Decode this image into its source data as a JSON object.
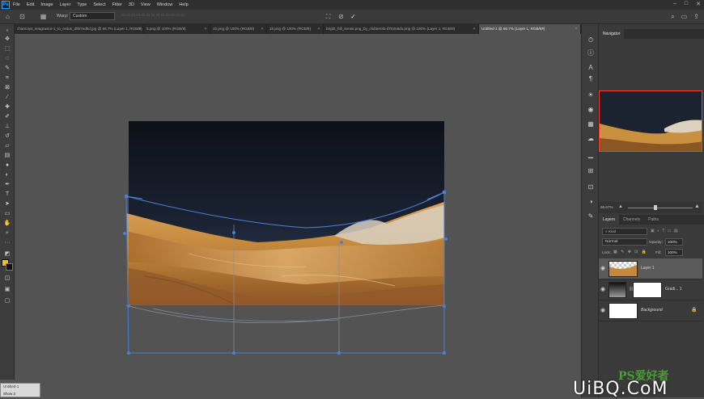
{
  "menu": {
    "logo": "Ps",
    "items": [
      "File",
      "Edit",
      "Image",
      "Layer",
      "Type",
      "Select",
      "Filter",
      "3D",
      "View",
      "Window",
      "Help"
    ]
  },
  "options": {
    "warp_label": "Warp:",
    "warp_value": "Custom"
  },
  "tabs": [
    {
      "label": "chamoiys_seagravior-1_to_redus_d9b7ed5d.jpg @ 66.7% (Layer 1, RGB/8)",
      "active": false
    },
    {
      "label": "5.png @ 100% (RGB/8)",
      "active": false
    },
    {
      "label": "10.png @ 100% (RGB/8)",
      "active": false
    },
    {
      "label": "15.png @ 100% (RGB/8)",
      "active": false
    },
    {
      "label": "bright_hill_sense.png_by_clubterolo-d7t4m8do.png @ 100% (Layer 1, RGB/8)",
      "active": false
    },
    {
      "label": "Untitled-1 @ 66.7% (Layer 1, RGB/8#)",
      "active": true
    }
  ],
  "navigator": {
    "tab": "Navigator",
    "zoom": "66.67%"
  },
  "layers_panel": {
    "tabs": [
      "Layers",
      "Channels",
      "Paths"
    ],
    "kind_placeholder": "Kind",
    "blend_mode": "Normal",
    "opacity_label": "Opacity:",
    "opacity_value": "100%",
    "lock_label": "Lock:",
    "fill_label": "Fill:",
    "fill_value": "100%",
    "layers": [
      {
        "name": "Layer 1",
        "selected": true
      },
      {
        "name": "Gradi... 1",
        "selected": false
      },
      {
        "name": "Background",
        "selected": false
      }
    ]
  },
  "bottom_mini": {
    "title": "Untitled-1",
    "label": "Show 2"
  },
  "watermark": {
    "top_text": "PS爱好者",
    "bottom_text": "UiBQ.CoM"
  },
  "colors": {
    "transform_blue": "#4a7fd4",
    "selection_red": "#ff3b30"
  }
}
